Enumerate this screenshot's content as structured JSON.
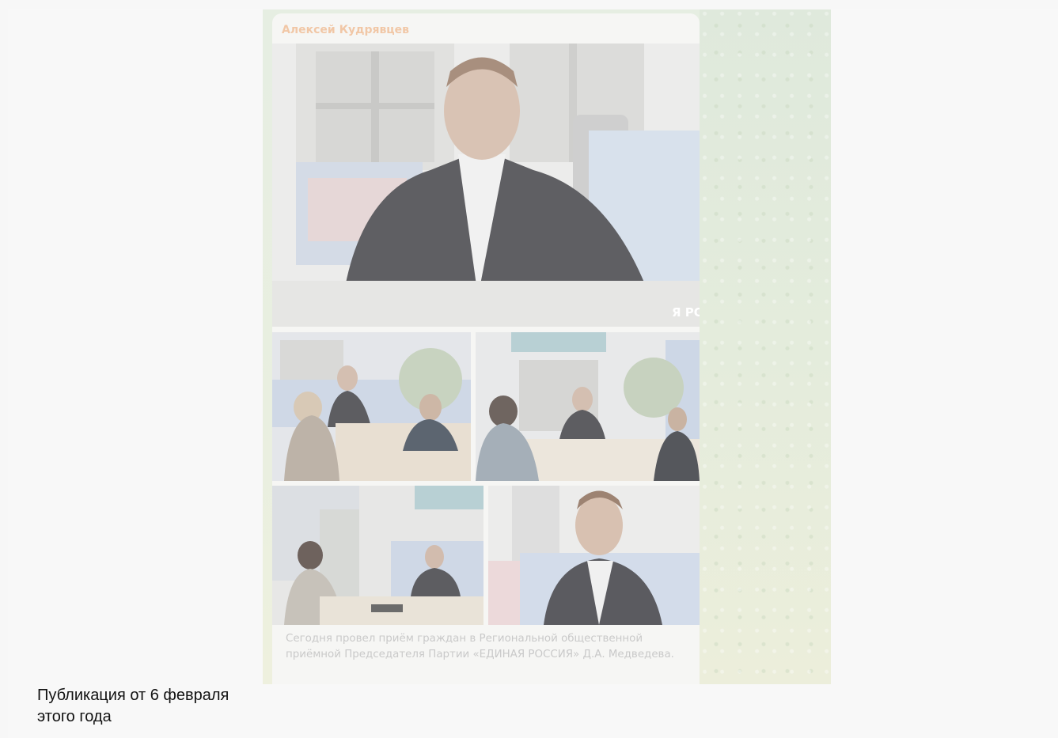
{
  "post": {
    "author": "Алексей Кудрявцев",
    "caption": "Сегодня провел приём граждан в Региональной общественной приёмной Председателя Партии «ЕДИНАЯ РОССИЯ» Д.А. Медведева.",
    "banner_text": "Я РО"
  },
  "footnote": "Публикация от 6 февраля этого года",
  "colors": {
    "author_name": "#f1c7a6",
    "caption_text": "#c9c9c9",
    "page_bg": "#f7f7f7",
    "chat_bg": "#e4ecdc"
  }
}
